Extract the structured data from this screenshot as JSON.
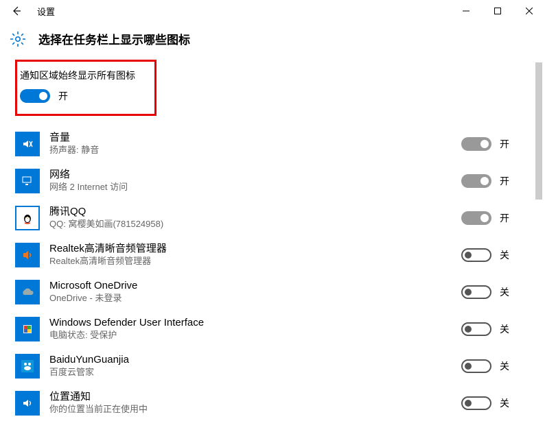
{
  "titlebar": {
    "app_title": "设置"
  },
  "header": {
    "page_title": "选择在任务栏上显示哪些图标"
  },
  "master": {
    "label": "通知区域始终显示所有图标",
    "state_label": "开",
    "on": true
  },
  "state_labels": {
    "on": "开",
    "off": "关"
  },
  "items": [
    {
      "title": "音量",
      "sub": "扬声器: 静音",
      "icon": "volume",
      "on": true,
      "disabled": true
    },
    {
      "title": "网络",
      "sub": "网络  2 Internet 访问",
      "icon": "network",
      "on": true,
      "disabled": true
    },
    {
      "title": "腾讯QQ",
      "sub": "QQ: 窝樱美如画(781524958)",
      "icon": "qq",
      "on": true,
      "disabled": true
    },
    {
      "title": "Realtek高清晰音频管理器",
      "sub": "Realtek高清晰音频管理器",
      "icon": "realtek",
      "on": false,
      "disabled": false
    },
    {
      "title": "Microsoft OneDrive",
      "sub": "OneDrive - 未登录",
      "icon": "onedrive",
      "on": false,
      "disabled": false
    },
    {
      "title": "Windows Defender User Interface",
      "sub": "电脑状态: 受保护",
      "icon": "defender",
      "on": false,
      "disabled": false
    },
    {
      "title": "BaiduYunGuanjia",
      "sub": "百度云管家",
      "icon": "baidu",
      "on": false,
      "disabled": false
    },
    {
      "title": "位置通知",
      "sub": "你的位置当前正在使用中",
      "icon": "location",
      "on": false,
      "disabled": false
    }
  ]
}
